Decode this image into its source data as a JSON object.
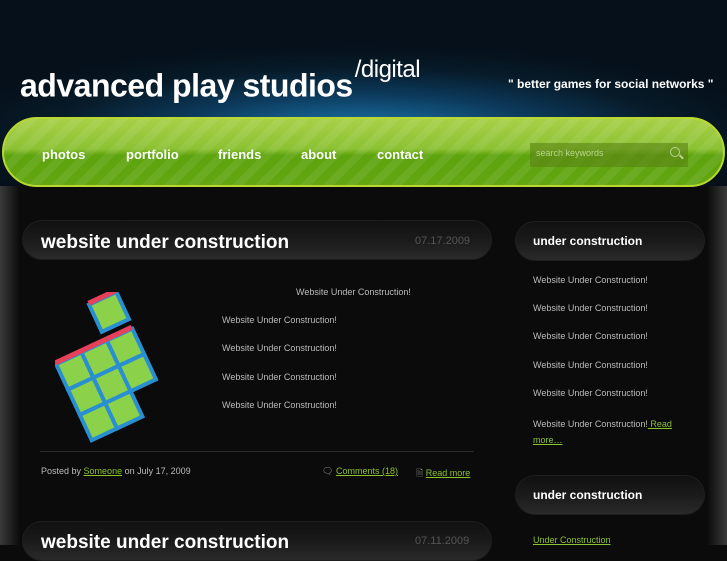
{
  "header": {
    "logo": "advanced play studios",
    "logo_sup": "/digital",
    "tagline": "\" better games for social networks \""
  },
  "nav": {
    "items": [
      "photos",
      "portfolio",
      "friends",
      "about",
      "contact"
    ],
    "search_placeholder": "search keywords"
  },
  "posts": [
    {
      "title": "website under construction",
      "date": "07.17.2009",
      "lines": [
        "Website Under Construction!",
        "Website Under Construction!",
        "Website Under Construction!",
        "Website Under Construction!",
        "Website Under Construction!"
      ],
      "posted_by": "Posted by",
      "author": "Someone",
      "on_date": "on July 17, 2009",
      "comments": "Comments (18)",
      "read_more": "Read more"
    },
    {
      "title": "website under construction",
      "date": "07.11.2009"
    }
  ],
  "sidebar": {
    "box1_title": "under construction",
    "box1_items": [
      "Website Under Construction!",
      "Website Under Construction!",
      "Website Under Construction!",
      "Website Under Construction!",
      "Website Under Construction!",
      "Website Under Construction!"
    ],
    "box1_more": " Read more…",
    "box2_title": "under construction",
    "box2_link": "Under Construction"
  },
  "colors": {
    "accent": "#8cc22a",
    "nav": "#7ab82a"
  }
}
